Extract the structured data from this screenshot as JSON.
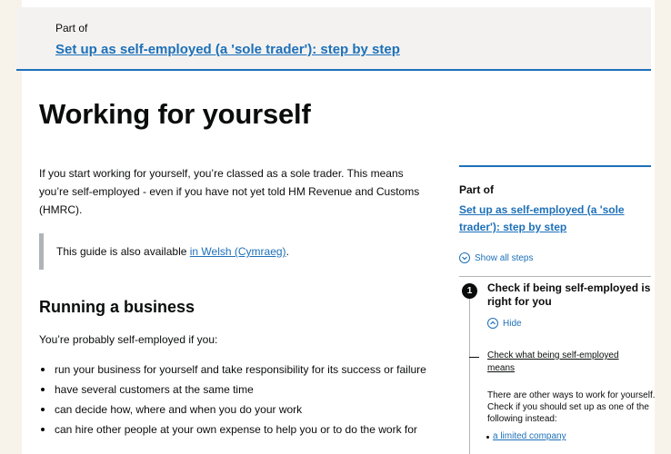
{
  "banner": {
    "part_of_label": "Part of",
    "link": "Set up as self-employed (a 'sole trader'): step by step"
  },
  "main": {
    "title": "Working for yourself",
    "intro": "If you start working for yourself, you’re classed as a sole trader. This means you’re self-employed - even if you have not yet told HM Revenue and Customs (HMRC).",
    "inset_prefix": "This guide is also available ",
    "inset_link": "in Welsh (Cymraeg)",
    "inset_suffix": ".",
    "section_heading": "Running a business",
    "lead": "You’re probably self-employed if you:",
    "bullets": [
      "run your business for yourself and take responsibility for its success or failure",
      "have several customers at the same time",
      "can decide how, where and when you do your work",
      "can hire other people at your own expense to help you or to do the work for"
    ]
  },
  "sidebar": {
    "part_of_label": "Part of",
    "link": "Set up as self-employed (a 'sole trader'): step by step",
    "show_all": "Show all steps",
    "step": {
      "number": "1",
      "title": "Check if being self-employed is right for you",
      "hide": "Hide",
      "link": "Check what being self-employed means",
      "text": "There are other ways to work for yourself. Check if you should set up as one of the following instead:",
      "sublink": "a limited company"
    }
  },
  "colors": {
    "link": "#1d70b8",
    "text": "#0b0c0c",
    "banner_bg": "#f3f2f1",
    "outer_bg": "#f8f3ea"
  }
}
